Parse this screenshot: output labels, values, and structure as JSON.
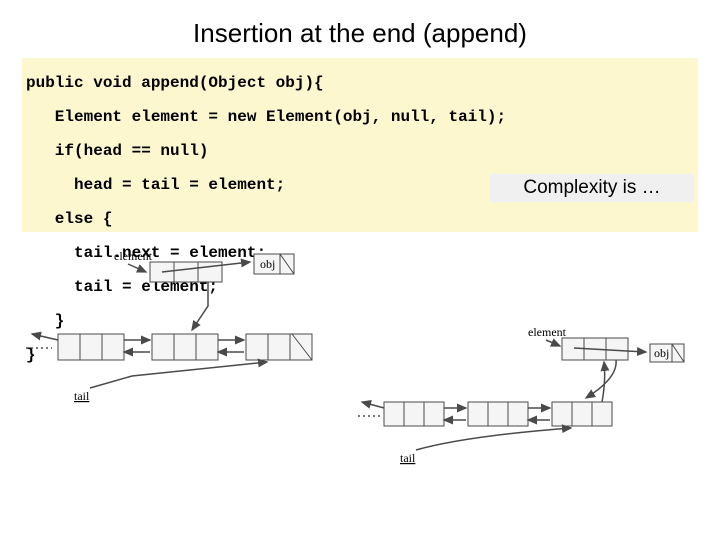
{
  "title": "Insertion at the end (append)",
  "code": {
    "l1": "public void append(Object obj){",
    "l2": "   Element element = new Element(obj, null, tail);",
    "l3": "   if(head == null)",
    "l4": "     head = tail = element;",
    "l5": "   else {",
    "l6": "     tail.next = element;",
    "l7": "     tail = element;",
    "l8": "   }",
    "l9": "}"
  },
  "complexity": "Complexity is …",
  "labels": {
    "element": "element",
    "obj": "obj",
    "tail": "tail"
  }
}
